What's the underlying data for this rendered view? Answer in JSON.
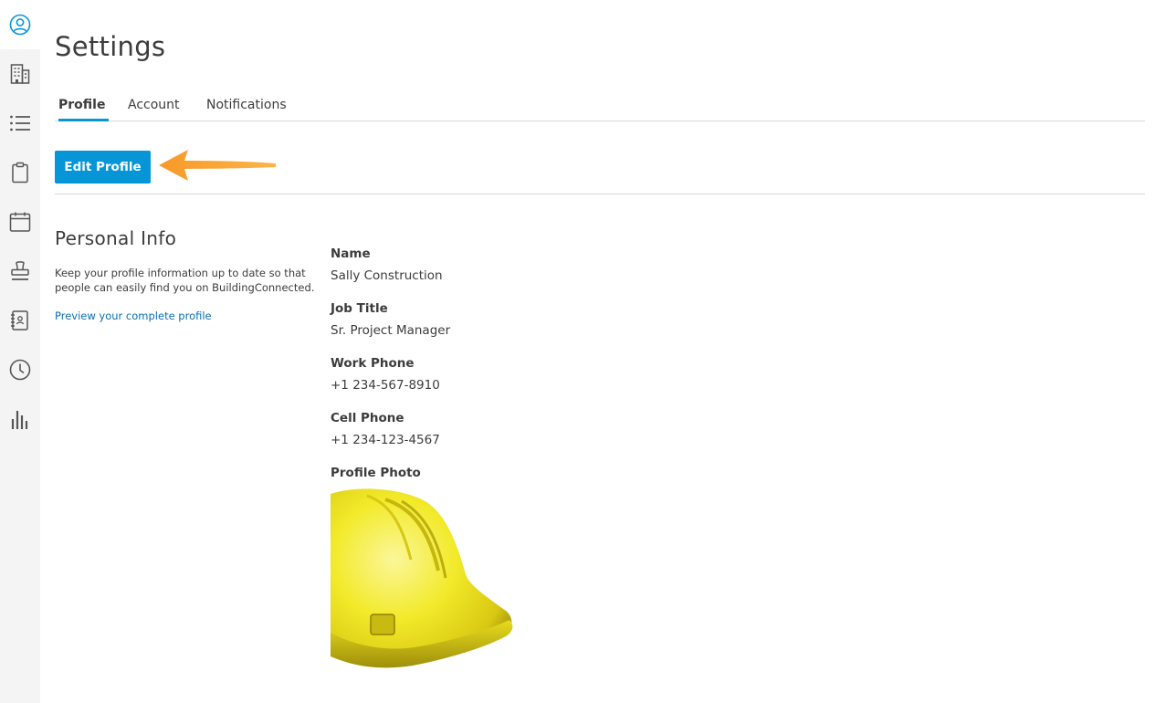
{
  "page": {
    "title": "Settings"
  },
  "tabs": [
    {
      "label": "Profile",
      "active": true
    },
    {
      "label": "Account",
      "active": false
    },
    {
      "label": "Notifications",
      "active": false
    }
  ],
  "actions": {
    "edit_label": "Edit Profile"
  },
  "personal_info": {
    "title": "Personal Info",
    "description": "Keep your profile information up to date so that people can easily find you on BuildingConnected.",
    "preview_link": "Preview your complete profile"
  },
  "fields": [
    {
      "label": "Name",
      "value": "Sally Construction"
    },
    {
      "label": "Job Title",
      "value": "Sr. Project Manager"
    },
    {
      "label": "Work Phone",
      "value": "+1 234-567-8910"
    },
    {
      "label": "Cell Phone",
      "value": "+1 234-123-4567"
    }
  ],
  "photo": {
    "label": "Profile Photo"
  },
  "sidebar": {
    "icons": [
      "user-circle-icon",
      "building-icon",
      "list-icon",
      "clipboard-icon",
      "calendar-icon",
      "stamp-icon",
      "address-book-icon",
      "clock-icon",
      "bar-chart-icon"
    ]
  },
  "colors": {
    "accent": "#0696d7",
    "link": "#0a6fb0",
    "arrow": "#f7941d",
    "sidebar_bg": "#f4f4f4"
  }
}
